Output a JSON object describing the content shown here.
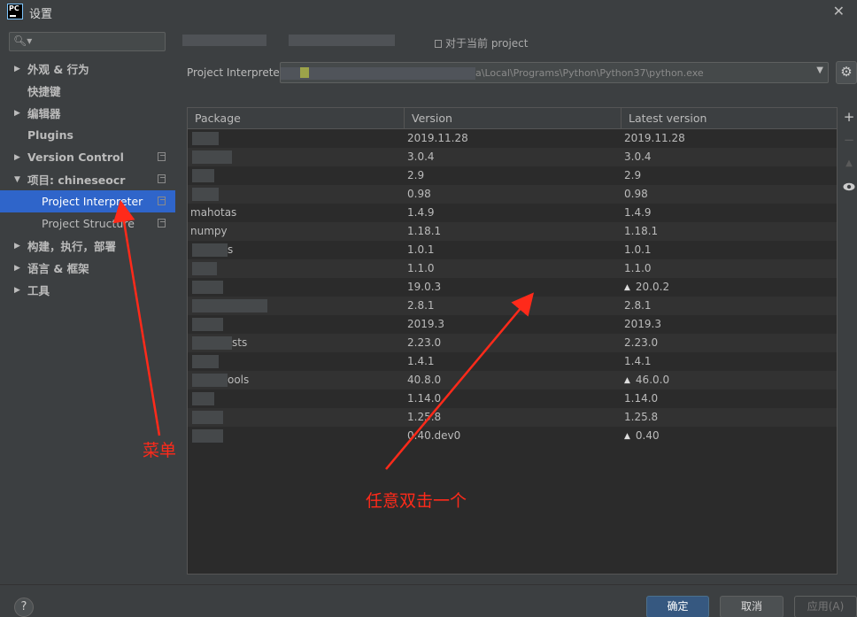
{
  "window": {
    "app_icon_text": "PC",
    "title": "设置",
    "close_glyph": "✕"
  },
  "sidebar": {
    "search_placeholder": "",
    "search_icon": "search-icon",
    "items": [
      {
        "label": "外观 & 行为",
        "expandable": true,
        "expanded": false,
        "bold": true,
        "copy_icon": false
      },
      {
        "label": "快捷键",
        "expandable": false,
        "bold": true,
        "copy_icon": false
      },
      {
        "label": "编辑器",
        "expandable": true,
        "expanded": false,
        "bold": true,
        "copy_icon": false
      },
      {
        "label": "Plugins",
        "expandable": false,
        "bold": true,
        "copy_icon": false
      },
      {
        "label": "Version Control",
        "expandable": true,
        "expanded": false,
        "bold": true,
        "copy_icon": true
      },
      {
        "label": "项目: chineseocr",
        "expandable": true,
        "expanded": true,
        "bold": true,
        "copy_icon": true
      },
      {
        "label": "Project Interpreter",
        "expandable": false,
        "bold": false,
        "child": true,
        "selected": true,
        "copy_icon": true
      },
      {
        "label": "Project Structure",
        "expandable": false,
        "bold": false,
        "child": true,
        "copy_icon": true
      },
      {
        "label": "构建，执行，部署",
        "expandable": true,
        "expanded": false,
        "bold": true,
        "copy_icon": false
      },
      {
        "label": "语言 & 框架",
        "expandable": true,
        "expanded": false,
        "bold": true,
        "copy_icon": false
      },
      {
        "label": "工具",
        "expandable": true,
        "expanded": false,
        "bold": true,
        "copy_icon": false
      }
    ]
  },
  "main": {
    "scope_note": "对于当前 project",
    "interpreter_label": "Project Interprete",
    "interpreter_path": "a\\Local\\Programs\\Python\\Python37\\python.exe",
    "table": {
      "columns": [
        "Package",
        "Version",
        "Latest version"
      ],
      "rows": [
        {
          "package": "",
          "version": "2019.11.28",
          "latest": "2019.11.28",
          "upgrade": false
        },
        {
          "package": "",
          "version": "3.0.4",
          "latest": "3.0.4",
          "upgrade": false
        },
        {
          "package": "",
          "version": "2.9",
          "latest": "2.9",
          "upgrade": false
        },
        {
          "package": "",
          "version": "0.98",
          "latest": "0.98",
          "upgrade": false
        },
        {
          "package": "mahotas",
          "version": "1.4.9",
          "latest": "1.4.9",
          "upgrade": false
        },
        {
          "package": "numpy",
          "version": "1.18.1",
          "latest": "1.18.1",
          "upgrade": false
        },
        {
          "package": "s",
          "version": "1.0.1",
          "latest": "1.0.1",
          "upgrade": false
        },
        {
          "package": "",
          "version": "1.1.0",
          "latest": "1.1.0",
          "upgrade": false
        },
        {
          "package": "",
          "version": "19.0.3",
          "latest": "20.0.2",
          "upgrade": true
        },
        {
          "package": "",
          "version": "2.8.1",
          "latest": "2.8.1",
          "upgrade": false
        },
        {
          "package": "",
          "version": "2019.3",
          "latest": "2019.3",
          "upgrade": false
        },
        {
          "package": "sts",
          "version": "2.23.0",
          "latest": "2.23.0",
          "upgrade": false
        },
        {
          "package": "",
          "version": "1.4.1",
          "latest": "1.4.1",
          "upgrade": false
        },
        {
          "package": "ools",
          "version": "40.8.0",
          "latest": "46.0.0",
          "upgrade": true
        },
        {
          "package": "",
          "version": "1.14.0",
          "latest": "1.14.0",
          "upgrade": false
        },
        {
          "package": "",
          "version": "1.25.8",
          "latest": "1.25.8",
          "upgrade": false
        },
        {
          "package": "",
          "version": "0.40.dev0",
          "latest": "0.40",
          "upgrade": true
        }
      ]
    },
    "tools": {
      "add": "+",
      "remove": "−",
      "upgrade": "▲",
      "show_early": "eye-icon"
    },
    "gear_icon": "gear-icon"
  },
  "annotations": {
    "menu_label": "菜单",
    "double_click_label": "任意双击一个",
    "color": "#ff2a1a"
  },
  "footer": {
    "help": "?",
    "ok": "确定",
    "cancel": "取消",
    "apply": "应用(A)"
  },
  "colors": {
    "background": "#3c3f41",
    "table_bg": "#2b2b2b",
    "selection": "#2f65ca",
    "ok_button": "#365880"
  }
}
